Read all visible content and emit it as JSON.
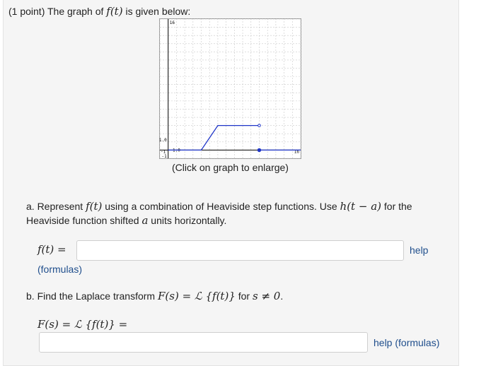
{
  "problem": {
    "intro_prefix": "(1 point) The graph of ",
    "intro_math": "f(t)",
    "intro_suffix": " is given below:"
  },
  "graph": {
    "caption": "(Click on graph to enlarge)",
    "tick_labels": {
      "y_top": "16",
      "y_one": "1.0",
      "x_one": "1.0",
      "x_left": "-1",
      "x_right": "16",
      "y_bottom": "-1"
    },
    "colors": {
      "line": "#1f35c8",
      "grid": "#c9c9c9",
      "axis": "#000000"
    },
    "chart_data": {
      "type": "line",
      "xlim": [
        -1,
        16
      ],
      "ylim": [
        -1,
        16
      ],
      "grid": true,
      "series": [
        {
          "x": [
            0,
            4,
            6,
            11
          ],
          "y": [
            0,
            0,
            3,
            3
          ],
          "end": "open"
        },
        {
          "x": [
            11,
            16
          ],
          "y": [
            0,
            0
          ],
          "start": "closed"
        }
      ]
    }
  },
  "part_a": {
    "text_1": "a. Represent ",
    "math_1": "f(t)",
    "text_2": " using a combination of Heaviside step functions. Use ",
    "math_2": "h(t − a)",
    "text_3": " for the Heaviside function shifted ",
    "math_3": "a",
    "text_4": " units horizontally.",
    "label": "f(t) =",
    "input_value": "",
    "help": "help",
    "formulas": "(formulas)"
  },
  "part_b": {
    "text_1": "b. Find the Laplace transform ",
    "math_1": "F(s) = ℒ {f(t)}",
    "text_2": " for ",
    "math_2": "s ≠ 0",
    "text_3": ".",
    "label": "F(s) = ℒ {f(t)} =",
    "input_value": "",
    "help": "help (formulas)"
  }
}
